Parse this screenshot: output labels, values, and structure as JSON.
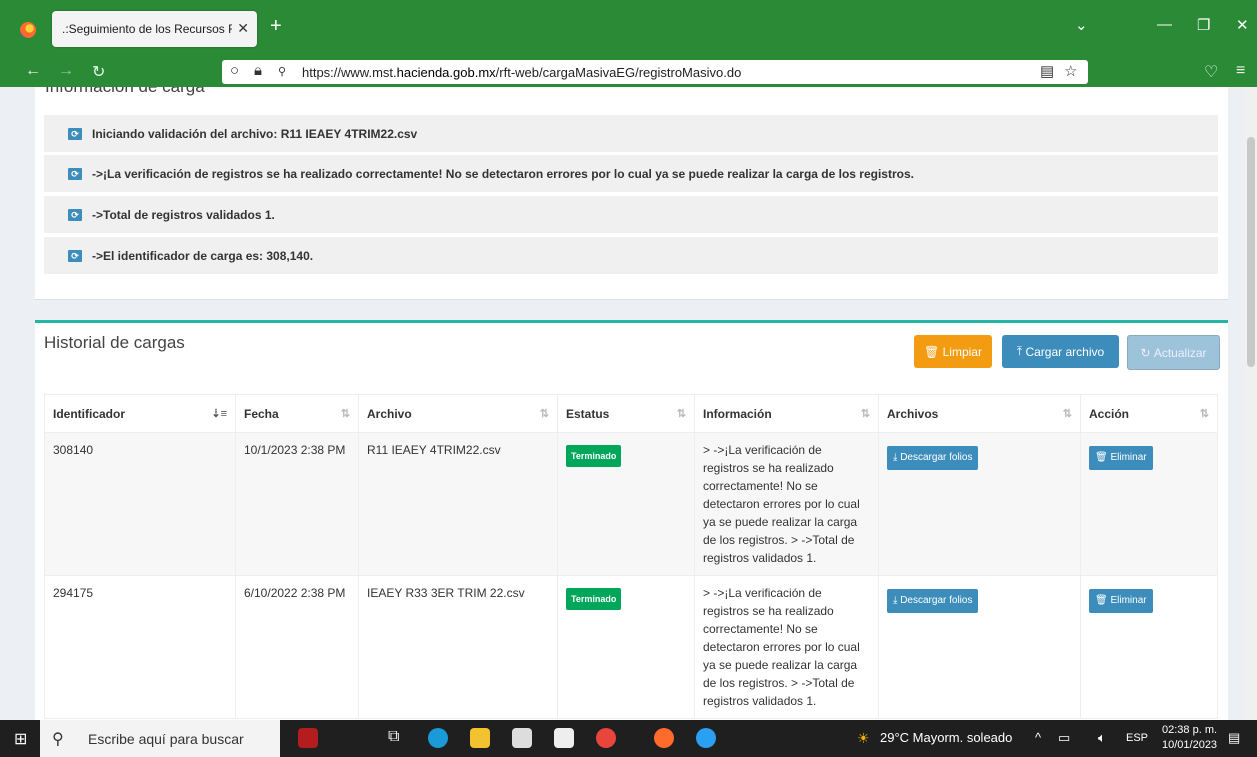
{
  "browser": {
    "tab_title": ".:Seguimiento de los Recursos Feder",
    "url_prefix": "https://www.mst.",
    "url_domain": "hacienda.gob.mx",
    "url_path": "/rft-web/cargaMasivaEG/registroMasivo.do"
  },
  "info_box": {
    "title": "Información de carga",
    "messages": [
      "Iniciando validación del archivo: R11 IEAEY 4TRIM22.csv",
      "->¡La verificación de registros se ha realizado correctamente! No se detectaron errores por lo cual ya se puede realizar la carga de los registros.",
      "->Total de registros validados 1.",
      "->El identificador de carga es: 308,140."
    ]
  },
  "history": {
    "title": "Historial de cargas",
    "btn_clear": "Limpiar",
    "btn_upload": "Cargar archivo",
    "btn_refresh": "Actualizar",
    "columns": [
      "Identificador",
      "Fecha",
      "Archivo",
      "Estatus",
      "Información",
      "Archivos",
      "Acción"
    ],
    "rows": [
      {
        "id": "308140",
        "date": "10/1/2023 2:38 PM",
        "file": "R11 IEAEY 4TRIM22.csv",
        "status": "Terminado",
        "info": "> ->¡La verificación de registros se ha realizado correctamente! No se detectaron errores por lo cual ya se puede realizar la carga de los registros. > ->Total de registros validados 1.",
        "download": "Descargar folios",
        "delete": "Eliminar"
      },
      {
        "id": "294175",
        "date": "6/10/2022 2:38 PM",
        "file": "IEAEY R33 3ER TRIM 22.csv",
        "status": "Terminado",
        "info": "> ->¡La verificación de registros se ha realizado correctamente! No se detectaron errores por lo cual ya se puede realizar la carga de los registros. > ->Total de registros validados 1.",
        "download": "Descargar folios",
        "delete": "Eliminar"
      }
    ]
  },
  "taskbar": {
    "search_placeholder": "Escribe aquí para buscar",
    "weather": "29°C  Mayorm. soleado",
    "lang": "ESP",
    "time": "02:38 p. m.",
    "date": "10/01/2023"
  }
}
